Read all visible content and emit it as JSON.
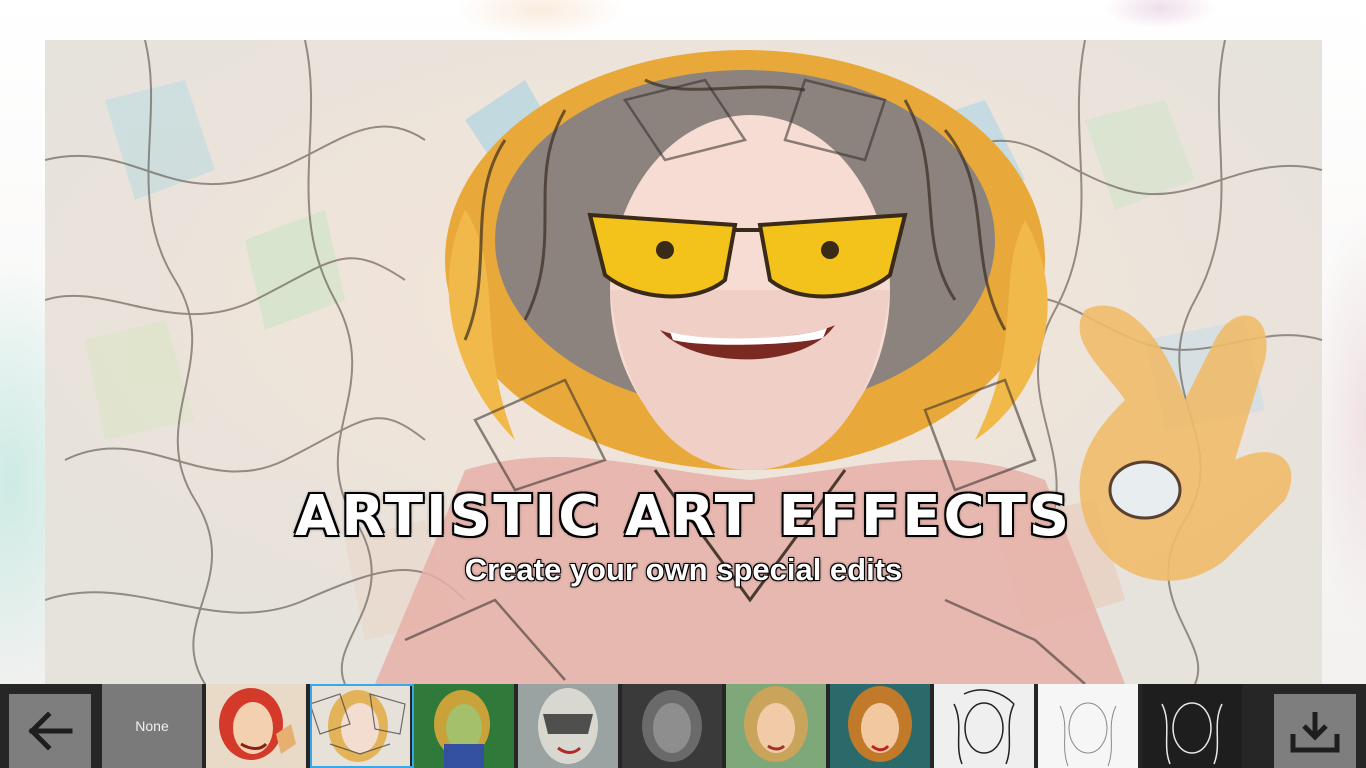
{
  "hero": {
    "title": "ARTISTIC ART EFFECTS",
    "subtitle": "Create your own special edits"
  },
  "filter_bar": {
    "back_icon": "arrow-left-icon",
    "download_icon": "download-icon",
    "none_label": "None",
    "selected_index": 1,
    "thumbnails": [
      {
        "style": "pop-red"
      },
      {
        "style": "stained-glass"
      },
      {
        "style": "green-comic"
      },
      {
        "style": "mask-sketch"
      },
      {
        "style": "dark-gray"
      },
      {
        "style": "natural-warm"
      },
      {
        "style": "vivid-color"
      },
      {
        "style": "ink-sketch"
      },
      {
        "style": "pencil-light"
      },
      {
        "style": "inverted-ink"
      }
    ]
  },
  "colors": {
    "bar_bg": "#262626",
    "button_bg": "#7e7e7e",
    "selected_border": "#3aa7e8"
  }
}
